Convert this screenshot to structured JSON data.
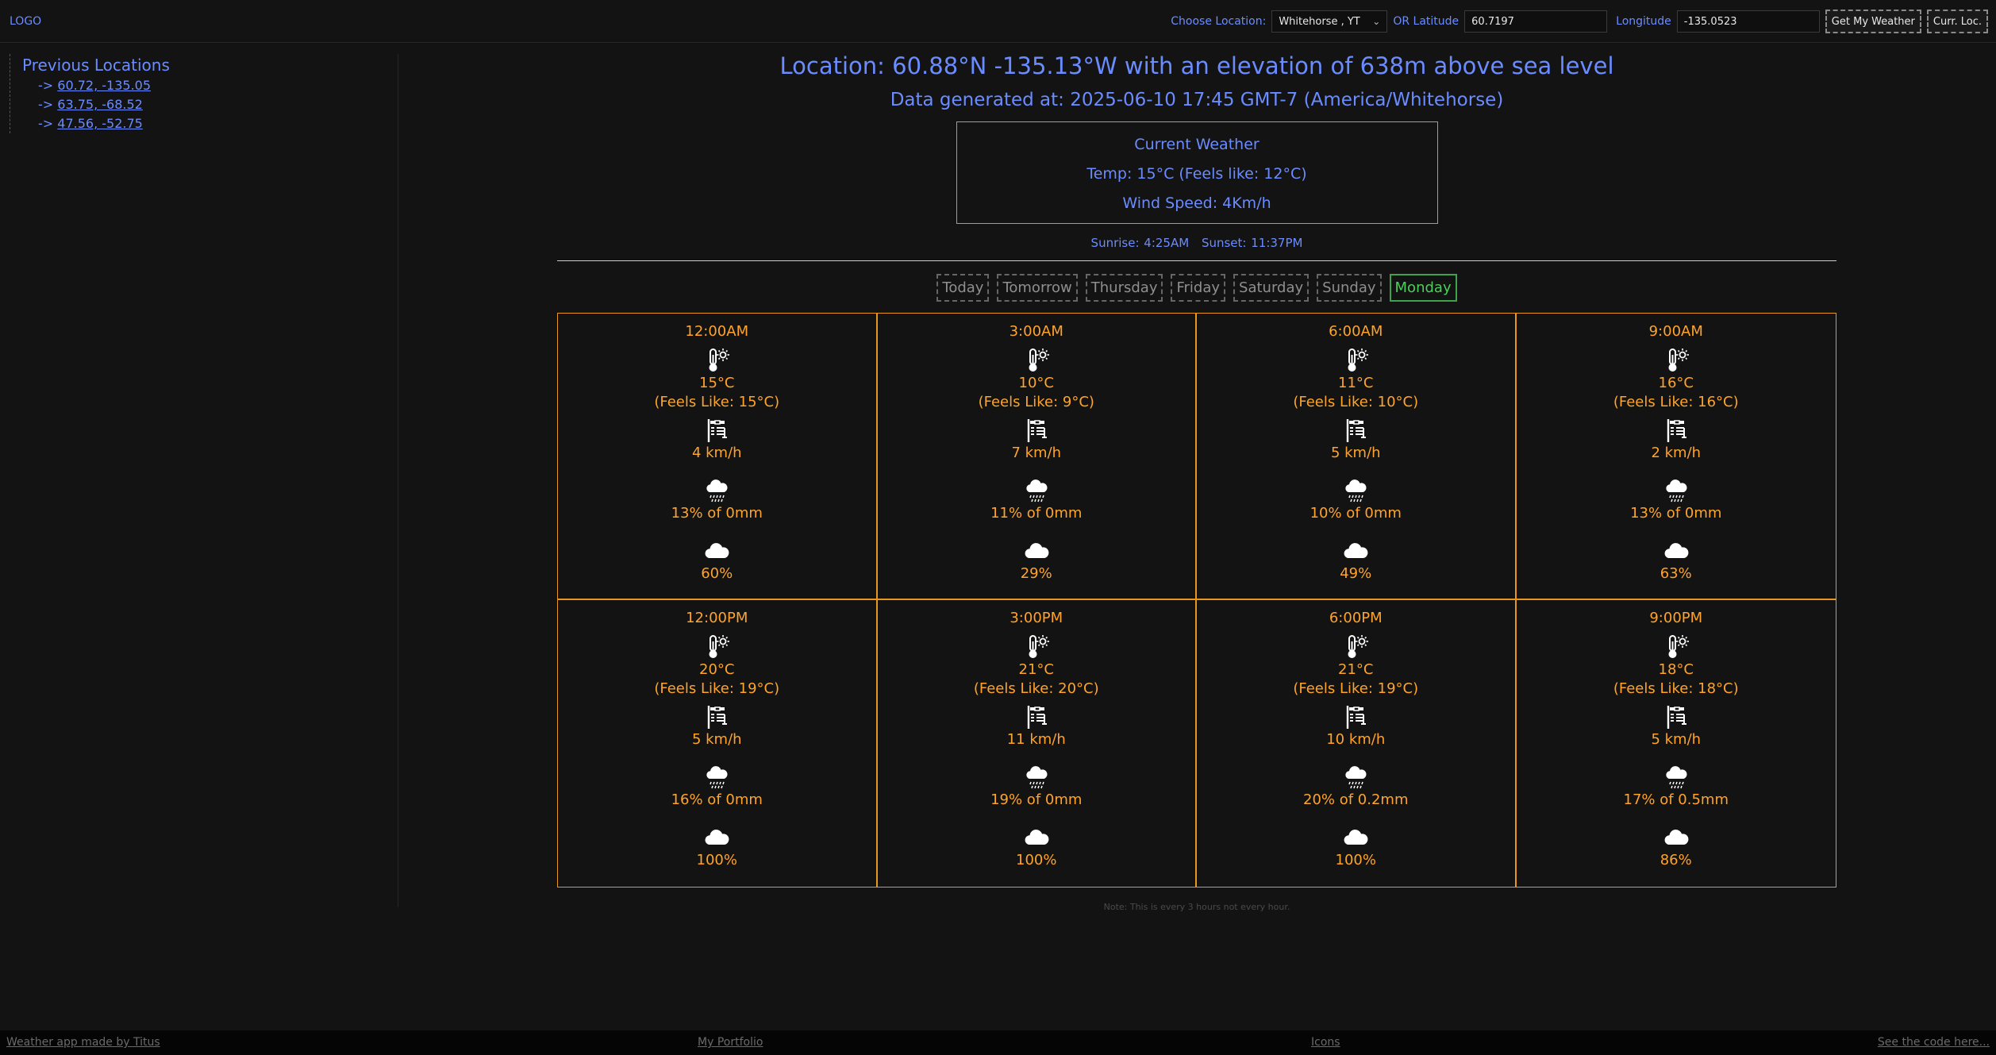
{
  "header": {
    "logo": "LOGO",
    "choose_label": "Choose Location:",
    "selected_location": "Whitehorse , YT",
    "or_lat_label": "OR Latitude",
    "latitude": "60.7197",
    "longitude_label": "Longitude",
    "longitude": "-135.0523",
    "get_weather": "Get My Weather",
    "curr_loc": "Curr. Loc."
  },
  "sidebar": {
    "title": "Previous Locations",
    "arrow": "->",
    "items": [
      "60.72, -135.05",
      "63.75, -68.52",
      "47.56, -52.75"
    ]
  },
  "main": {
    "location_title": "Location: 60.88°N -135.13°W with an elevation of 638m above sea level",
    "generated": "Data generated at: 2025-06-10 17:45 GMT-7 (America/Whitehorse)",
    "current": {
      "title": "Current Weather",
      "temp": "Temp: 15°C (Feels like: 12°C)",
      "wind": "Wind Speed: 4Km/h"
    },
    "sunrise": "Sunrise: 4:25AM",
    "sunset": "Sunset: 11:37PM",
    "tabs": [
      "Today",
      "Tomorrow",
      "Thursday",
      "Friday",
      "Saturday",
      "Sunday",
      "Monday"
    ],
    "active_tab": "Monday",
    "hours": [
      {
        "time": "12:00AM",
        "temp": "15°C",
        "feels": "(Feels Like: 15°C)",
        "wind": "4 km/h",
        "precip": "13% of 0mm",
        "cloud": "60%"
      },
      {
        "time": "3:00AM",
        "temp": "10°C",
        "feels": "(Feels Like: 9°C)",
        "wind": "7 km/h",
        "precip": "11% of 0mm",
        "cloud": "29%"
      },
      {
        "time": "6:00AM",
        "temp": "11°C",
        "feels": "(Feels Like: 10°C)",
        "wind": "5 km/h",
        "precip": "10% of 0mm",
        "cloud": "49%"
      },
      {
        "time": "9:00AM",
        "temp": "16°C",
        "feels": "(Feels Like: 16°C)",
        "wind": "2 km/h",
        "precip": "13% of 0mm",
        "cloud": "63%"
      },
      {
        "time": "12:00PM",
        "temp": "20°C",
        "feels": "(Feels Like: 19°C)",
        "wind": "5 km/h",
        "precip": "16% of 0mm",
        "cloud": "100%"
      },
      {
        "time": "3:00PM",
        "temp": "21°C",
        "feels": "(Feels Like: 20°C)",
        "wind": "11 km/h",
        "precip": "19% of 0mm",
        "cloud": "100%"
      },
      {
        "time": "6:00PM",
        "temp": "21°C",
        "feels": "(Feels Like: 19°C)",
        "wind": "10 km/h",
        "precip": "20% of 0.2mm",
        "cloud": "100%"
      },
      {
        "time": "9:00PM",
        "temp": "18°C",
        "feels": "(Feels Like: 18°C)",
        "wind": "5 km/h",
        "precip": "17% of 0.5mm",
        "cloud": "86%"
      }
    ],
    "note": "Note: This is every 3 hours not every hour."
  },
  "footer": {
    "made_by": "Weather app made by Titus",
    "portfolio": "My Portfolio",
    "icons": "Icons",
    "code": "See the code here..."
  },
  "colors": {
    "background": "#131313",
    "accent": "#6b8cff",
    "orange": "#ffa42b",
    "active_tab": "#4ccf5a"
  }
}
